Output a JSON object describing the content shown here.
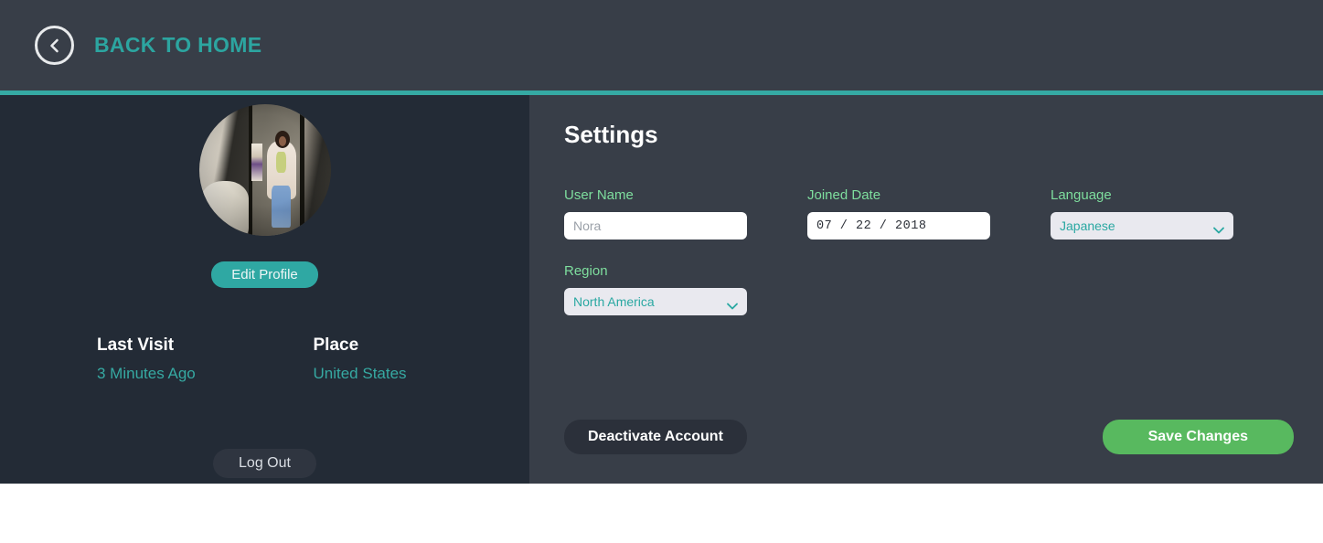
{
  "header": {
    "back_label": "BACK TO HOME",
    "back_icon": "chevron-left-circle-icon",
    "accent_color": "#2ca5a0",
    "divider_color": "#35aaa4"
  },
  "sidebar": {
    "avatar_alt": "woman in white blazer at storefront with pink flowers",
    "edit_profile_label": "Edit Profile",
    "logout_label": "Log Out",
    "stats": [
      {
        "title": "Last Visit",
        "value": "3 Minutes Ago"
      },
      {
        "title": "Place",
        "value": "United States"
      }
    ],
    "background_color": "#232b36",
    "value_color": "#36a9a2"
  },
  "panel": {
    "title": "Settings",
    "label_color": "#7ede9e",
    "background_color": "#383e48",
    "fields": {
      "user_name": {
        "label": "User Name",
        "value": "",
        "placeholder": "Nora"
      },
      "joined_date": {
        "label": "Joined Date",
        "value": "07 / 22 / 2018"
      },
      "language": {
        "label": "Language",
        "value": "Japanese",
        "options": [
          "Japanese"
        ],
        "chevron_icon": "chevron-down-icon"
      },
      "region": {
        "label": "Region",
        "value": "North America",
        "options": [
          "North America"
        ],
        "chevron_icon": "chevron-down-icon"
      }
    },
    "actions": {
      "deactivate_label": "Deactivate Account",
      "save_label": "Save Changes",
      "save_color": "#58b95f"
    }
  }
}
